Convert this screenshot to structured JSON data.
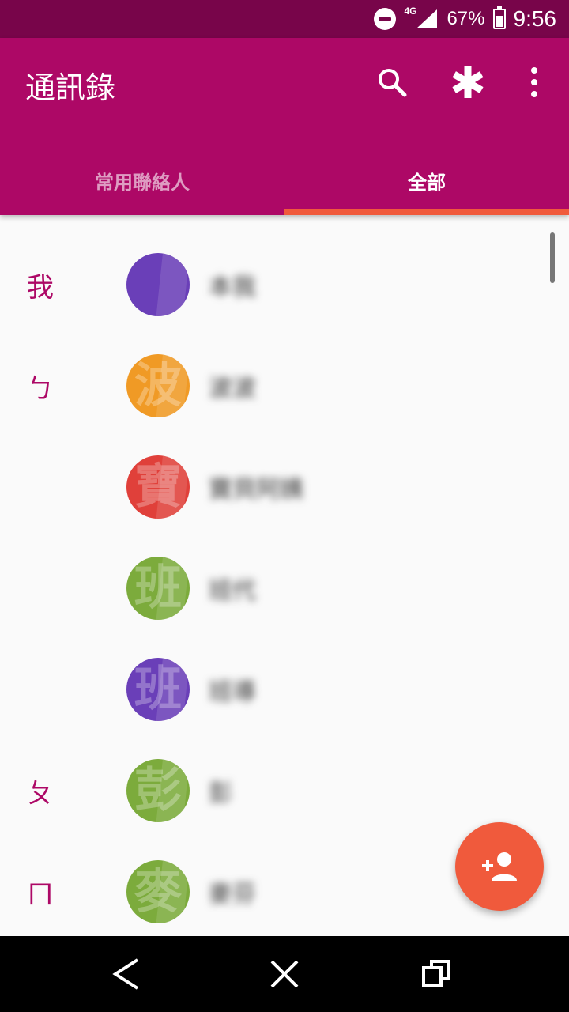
{
  "status_bar": {
    "network": "4G",
    "battery": "67%",
    "time": "9:56",
    "icons": [
      "do-not-disturb-icon",
      "signal-icon",
      "battery-charging-icon"
    ]
  },
  "app_bar": {
    "title": "通訊錄",
    "actions": [
      "search-icon",
      "asterisk-icon",
      "more-vert-icon"
    ]
  },
  "tabs": [
    {
      "label": "常用聯絡人",
      "active": false
    },
    {
      "label": "全部",
      "active": true
    }
  ],
  "contacts": [
    {
      "section": "我",
      "name": "本我",
      "avatar_color": "#6a3fb8",
      "avatar_glyph": ""
    },
    {
      "section": "ㄅ",
      "name": "波波",
      "avatar_color": "#f09a25",
      "avatar_glyph": "波"
    },
    {
      "section": "",
      "name": "寶貝阿姨",
      "avatar_color": "#e0403a",
      "avatar_glyph": "寶"
    },
    {
      "section": "",
      "name": "班代",
      "avatar_color": "#7cab3c",
      "avatar_glyph": "班"
    },
    {
      "section": "",
      "name": "班導",
      "avatar_color": "#6a3fb8",
      "avatar_glyph": "班"
    },
    {
      "section": "ㄆ",
      "name": "彭",
      "avatar_color": "#7cab3c",
      "avatar_glyph": "彭"
    },
    {
      "section": "ㄇ",
      "name": "麥芬",
      "avatar_color": "#7cab3c",
      "avatar_glyph": "麥"
    }
  ],
  "fab": {
    "icon": "add-contact-icon"
  },
  "nav_bar": {
    "icons": [
      "back-icon",
      "home-icon",
      "recents-icon"
    ]
  },
  "colors": {
    "primary": "#ad0866",
    "primary_dark": "#78054a",
    "accent": "#f05a3c"
  }
}
